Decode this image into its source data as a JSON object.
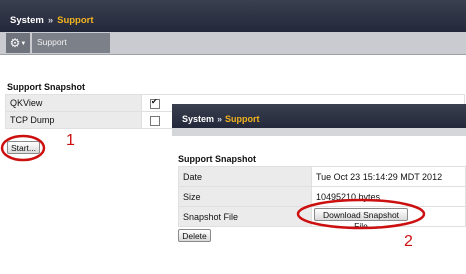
{
  "header": {
    "breadcrumb_root": "System",
    "breadcrumb_sep": "»",
    "breadcrumb_current": "Support"
  },
  "subnav": {
    "tab_label": "Support"
  },
  "snapshot": {
    "title": "Support Snapshot",
    "rows": [
      {
        "label": "QKView",
        "checked": true
      },
      {
        "label": "TCP Dump",
        "checked": false
      }
    ],
    "start_button": "Start..."
  },
  "popup": {
    "breadcrumb_root": "System",
    "breadcrumb_sep": "»",
    "breadcrumb_current": "Support",
    "title": "Support Snapshot",
    "rows": [
      {
        "label": "Date",
        "value": "Tue Oct 23 15:14:29 MDT 2012"
      },
      {
        "label": "Size",
        "value": "10495210 bytes"
      },
      {
        "label": "Snapshot File",
        "button": "Download Snapshot File"
      }
    ],
    "delete_button": "Delete"
  },
  "annotations": {
    "marker_1": "1",
    "marker_2": "2",
    "color": "#cc0f0f"
  },
  "icons": {
    "gear": "gear-icon",
    "caret": "chevron-down-icon",
    "check": "checkmark-icon"
  }
}
